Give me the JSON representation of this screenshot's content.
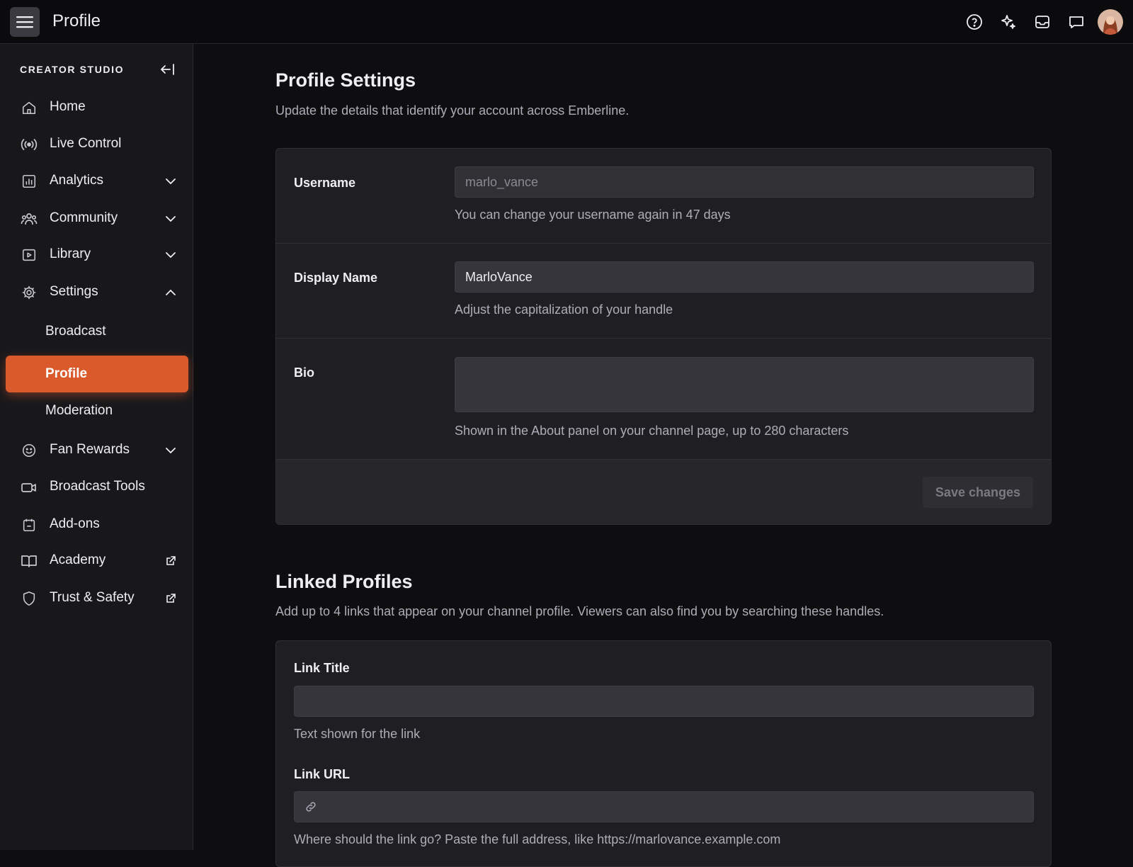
{
  "header": {
    "title": "Profile",
    "icons": [
      "help-icon",
      "sparkle-icon",
      "inbox-icon",
      "chat-icon"
    ]
  },
  "sidebar": {
    "heading": "CREATOR STUDIO",
    "items": [
      {
        "label": "Home",
        "icon": "home-icon"
      },
      {
        "label": "Live Control",
        "icon": "broadcast-signal-icon"
      },
      {
        "label": "Analytics",
        "icon": "analytics-icon",
        "expandable": true
      },
      {
        "label": "Community",
        "icon": "community-icon",
        "expandable": true
      },
      {
        "label": "Library",
        "icon": "library-icon",
        "expandable": true
      },
      {
        "label": "Settings",
        "icon": "gear-icon",
        "expanded": true
      },
      {
        "label": "Fan Rewards",
        "icon": "smile-icon",
        "expandable": true
      },
      {
        "label": "Broadcast Tools",
        "icon": "camera-icon"
      },
      {
        "label": "Add-ons",
        "icon": "calendar-icon"
      },
      {
        "label": "Academy",
        "icon": "book-icon",
        "external": true
      },
      {
        "label": "Trust & Safety",
        "icon": "shield-icon",
        "external": true
      }
    ],
    "settings_sub": [
      {
        "label": "Broadcast"
      },
      {
        "label": "Profile",
        "active": true
      },
      {
        "label": "Moderation"
      }
    ]
  },
  "profile_settings": {
    "title": "Profile Settings",
    "subtitle": "Update the details that identify your account across Emberline.",
    "username": {
      "label": "Username",
      "value": "marlo_vance",
      "hint": "You can change your username again in 47 days"
    },
    "display_name": {
      "label": "Display Name",
      "value": "MarloVance",
      "hint": "Adjust the capitalization of your handle"
    },
    "bio": {
      "label": "Bio",
      "value": "",
      "hint": "Shown in the About panel on your channel page, up to 280 characters"
    },
    "save_label": "Save changes"
  },
  "linked_profiles": {
    "title": "Linked Profiles",
    "subtitle": "Add up to 4 links that appear on your channel profile. Viewers can also find you by searching these handles.",
    "link_title": {
      "label": "Link Title",
      "value": "",
      "hint": "Text shown for the link"
    },
    "link_url": {
      "label": "Link URL",
      "value": "",
      "hint": "Where should the link go? Paste the full address, like https://marlovance.example.com"
    }
  },
  "colors": {
    "accent": "#db5a2c",
    "background": "#0e0e10",
    "sidebar": "#18181b",
    "card": "#1f1f23"
  }
}
